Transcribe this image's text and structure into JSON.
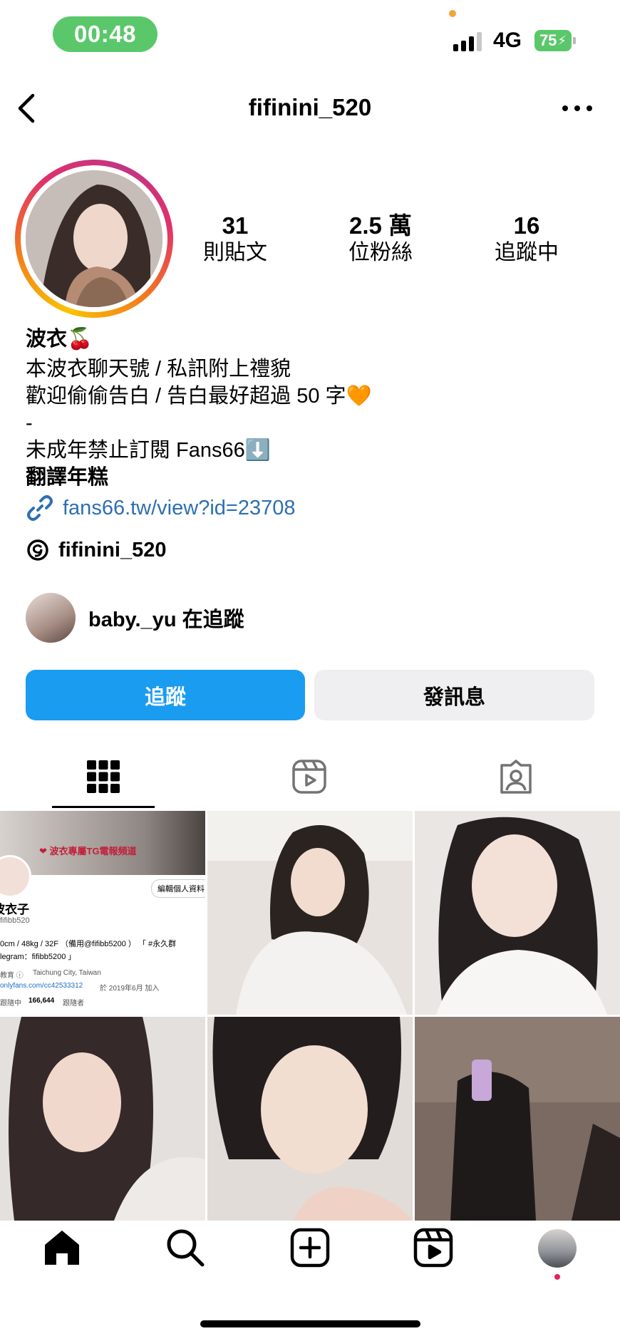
{
  "status_bar": {
    "time": "00:48",
    "network": "4G",
    "battery": "75"
  },
  "header": {
    "username": "fifinini_520"
  },
  "stats": [
    {
      "value": "31",
      "label": "則貼文"
    },
    {
      "value": "2.5 萬",
      "label": "位粉絲"
    },
    {
      "value": "16",
      "label": "追蹤中"
    }
  ],
  "bio": {
    "name": "波衣🍒",
    "line1": "本波衣聊天號 / 私訊附上禮貌",
    "line2": "歡迎偷偷告白 / 告白最好超過 50 字🧡",
    "line3": "-",
    "line4": "未成年禁止訂閱 Fans66⬇️",
    "translate": "翻譯年糕",
    "link": "fans66.tw/view?id=23708"
  },
  "threads": {
    "handle": "fifinini_520"
  },
  "mutual": {
    "text": "baby._yu 在追蹤"
  },
  "buttons": {
    "follow": "追蹤",
    "message": "發訊息"
  },
  "tabs": [
    "grid-icon",
    "reels-icon",
    "tagged-icon"
  ],
  "grid_post1": {
    "banner": "❤ 波衣專屬TG電報頻道",
    "edit_btn": "編輯個人資料",
    "name": "波衣子",
    "handle": "fifibb520",
    "line1": "0cm / 48kg / 32F （備用@fifibb5200 ） 「 #永久群",
    "line2": "legram：fifibb5200 」",
    "edu": "教育 ⓘ",
    "location": "Taichung City, Taiwan",
    "url": "onlyfans.com/cc42533312",
    "joined": "於 2019年6月 加入",
    "counts_a": "跟隨中",
    "counts_b": "166,644",
    "counts_c": "跟隨者"
  },
  "nav": [
    "home-icon",
    "search-icon",
    "create-icon",
    "reels-icon",
    "profile-avatar"
  ]
}
